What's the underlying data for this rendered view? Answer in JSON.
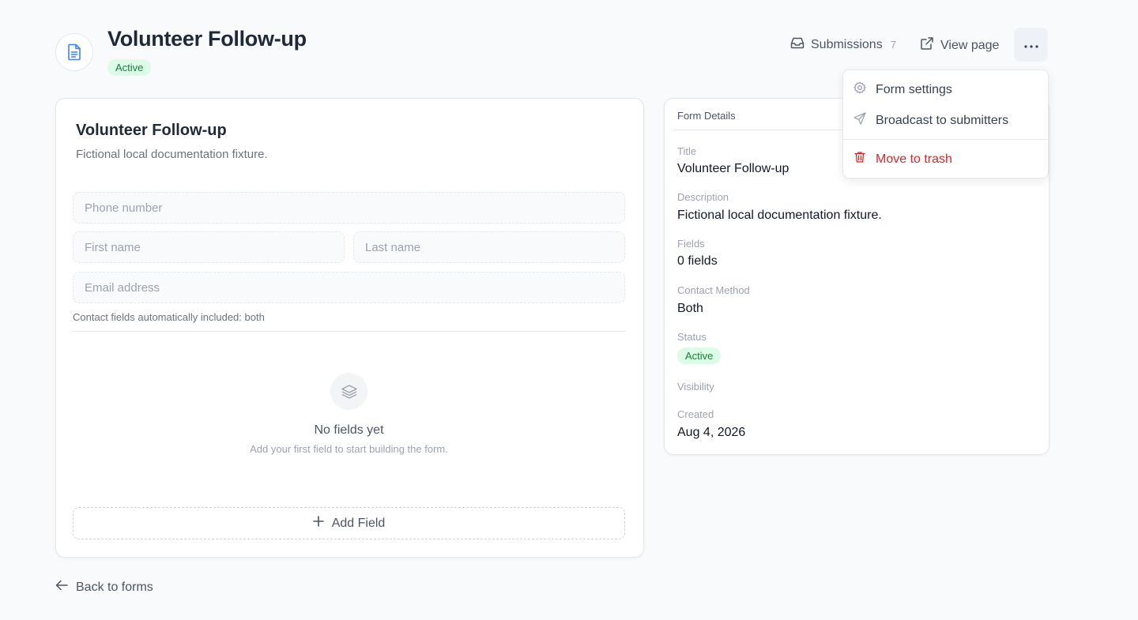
{
  "header": {
    "title": "Volunteer Follow-up",
    "status": "Active",
    "submissions_label": "Submissions",
    "submissions_count": "7",
    "view_page_label": "View page"
  },
  "menu": {
    "items": [
      {
        "label": "Form settings",
        "icon": "gear-icon"
      },
      {
        "label": "Broadcast to submitters",
        "icon": "send-icon"
      },
      {
        "label": "Move to trash",
        "icon": "trash-icon",
        "color": "#dc2626"
      }
    ]
  },
  "form": {
    "title": "Volunteer Follow-up",
    "description": "Fictional local documentation fixture.",
    "phone_placeholder": "Phone number",
    "first_placeholder": "First name",
    "last_placeholder": "Last name",
    "email_placeholder": "Email address",
    "contact_note": "Contact fields automatically included: both",
    "empty_title": "No fields yet",
    "empty_subtitle": "Add your first field to start building the form.",
    "add_field_label": "Add Field"
  },
  "details": {
    "heading": "Form Details",
    "title_label": "Title",
    "title_value": "Volunteer Follow-up",
    "description_label": "Description",
    "description_value": "Fictional local documentation fixture.",
    "fields_label": "Fields",
    "fields_value": "0 fields",
    "contact_label": "Contact Method",
    "contact_value": "Both",
    "status_label": "Status",
    "status_value": "Active",
    "visibility_label": "Visibility",
    "created_label": "Created",
    "created_value": "Aug 4, 2026"
  },
  "footer": {
    "back_label": "Back to forms"
  },
  "colors": {
    "accent": "#3b82f6",
    "success_bg": "#dcfce7",
    "success_text": "#15803d",
    "danger": "#dc2626"
  }
}
